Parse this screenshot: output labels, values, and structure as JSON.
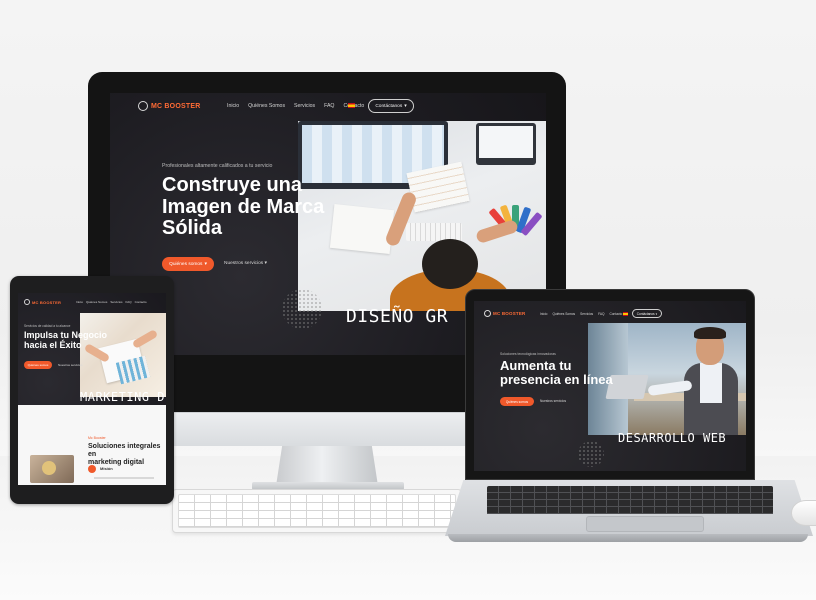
{
  "brand": {
    "name": "MC BOOSTER",
    "accent": "#f0592b",
    "dark": "#1d1c21"
  },
  "desktop": {
    "nav": [
      "Inicio",
      "Quiénes Somos",
      "Servicios",
      "FAQ",
      "Contacto"
    ],
    "pill": "Contáctanos",
    "kicker": "Profesionales altamente calificados a tu servicio",
    "headline": [
      "Construye una",
      "Imagen de Marca",
      "Sólida"
    ],
    "cta": "Quiénes somos",
    "link": "Nuestros servicios",
    "overlay": "DISEÑO GR"
  },
  "tablet": {
    "nav": [
      "Inicio",
      "Quiénes Somos",
      "Servicios",
      "FAQ",
      "Contacto"
    ],
    "kicker": "Servicios de calidad a tu alcance",
    "headline": [
      "Impulsa tu Negocio",
      "hacia el Éxito"
    ],
    "cta": "Quiénes somos",
    "link": "Nuestros servicios",
    "overlay": "MARKETING DI",
    "section_kicker": "Mc Booster",
    "section_title": [
      "Soluciones integrales en",
      "marketing digital"
    ],
    "section_item": "Misión"
  },
  "laptop": {
    "nav": [
      "Inicio",
      "Quiénes Somos",
      "Servicios",
      "FAQ",
      "Contacto"
    ],
    "pill": "Contáctanos",
    "kicker": "Soluciones tecnológicas innovadoras",
    "headline": [
      "Aumenta tu",
      "presencia en línea"
    ],
    "cta": "Quiénes somos",
    "link": "Nuestros servicios",
    "overlay": "DESARROLLO WEB"
  }
}
